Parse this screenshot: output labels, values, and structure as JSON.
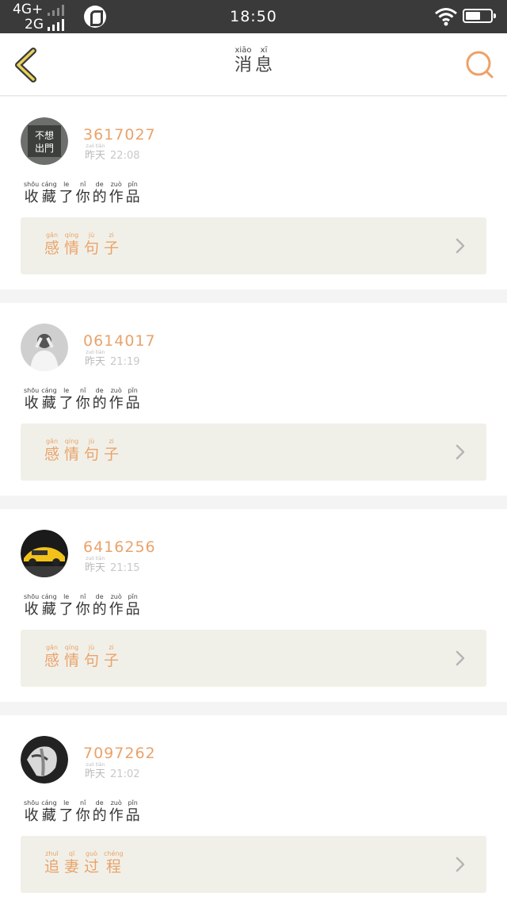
{
  "status_bar": {
    "network_top": "4G+",
    "network_bottom": "2G",
    "time": "18:50"
  },
  "header": {
    "title": [
      {
        "han": "消",
        "pin": "xiāo"
      },
      {
        "han": "息",
        "pin": "xī"
      }
    ]
  },
  "colors": {
    "accent": "#e9a36b",
    "work_bg": "#f1f0e8",
    "status_bg": "#3a3a3a"
  },
  "messages": [
    {
      "username": "3617027",
      "day": [
        {
          "han": "昨",
          "pin": "zuó"
        },
        {
          "han": "天",
          "pin": "tiān"
        }
      ],
      "time": "22:08",
      "action": [
        {
          "han": "收",
          "pin": "shōu"
        },
        {
          "han": "藏",
          "pin": "cáng"
        },
        {
          "han": "了",
          "pin": "le"
        },
        {
          "han": "你",
          "pin": "nǐ"
        },
        {
          "han": "的",
          "pin": "de"
        },
        {
          "han": "作",
          "pin": "zuò"
        },
        {
          "han": "品",
          "pin": "pǐn"
        }
      ],
      "work": [
        {
          "han": "感",
          "pin": "gǎn"
        },
        {
          "han": "情",
          "pin": "qíng"
        },
        {
          "han": "句",
          "pin": "jù"
        },
        {
          "han": "子",
          "pin": "zi"
        }
      ],
      "avatar": "avatar-text-image"
    },
    {
      "username": "0614017",
      "day": [
        {
          "han": "昨",
          "pin": "zuó"
        },
        {
          "han": "天",
          "pin": "tiān"
        }
      ],
      "time": "21:19",
      "action": [
        {
          "han": "收",
          "pin": "shōu"
        },
        {
          "han": "藏",
          "pin": "cáng"
        },
        {
          "han": "了",
          "pin": "le"
        },
        {
          "han": "你",
          "pin": "nǐ"
        },
        {
          "han": "的",
          "pin": "de"
        },
        {
          "han": "作",
          "pin": "zuò"
        },
        {
          "han": "品",
          "pin": "pǐn"
        }
      ],
      "work": [
        {
          "han": "感",
          "pin": "gǎn"
        },
        {
          "han": "情",
          "pin": "qíng"
        },
        {
          "han": "句",
          "pin": "jù"
        },
        {
          "han": "子",
          "pin": "zi"
        }
      ],
      "avatar": "avatar-person-photo"
    },
    {
      "username": "6416256",
      "day": [
        {
          "han": "昨",
          "pin": "zuó"
        },
        {
          "han": "天",
          "pin": "tiān"
        }
      ],
      "time": "21:15",
      "action": [
        {
          "han": "收",
          "pin": "shōu"
        },
        {
          "han": "藏",
          "pin": "cáng"
        },
        {
          "han": "了",
          "pin": "le"
        },
        {
          "han": "你",
          "pin": "nǐ"
        },
        {
          "han": "的",
          "pin": "de"
        },
        {
          "han": "作",
          "pin": "zuò"
        },
        {
          "han": "品",
          "pin": "pǐn"
        }
      ],
      "work": [
        {
          "han": "感",
          "pin": "gǎn"
        },
        {
          "han": "情",
          "pin": "qíng"
        },
        {
          "han": "句",
          "pin": "jù"
        },
        {
          "han": "子",
          "pin": "zi"
        }
      ],
      "avatar": "avatar-car-photo"
    },
    {
      "username": "7097262",
      "day": [
        {
          "han": "昨",
          "pin": "zuó"
        },
        {
          "han": "天",
          "pin": "tiān"
        }
      ],
      "time": "21:02",
      "action": [
        {
          "han": "收",
          "pin": "shōu"
        },
        {
          "han": "藏",
          "pin": "cáng"
        },
        {
          "han": "了",
          "pin": "le"
        },
        {
          "han": "你",
          "pin": "nǐ"
        },
        {
          "han": "的",
          "pin": "de"
        },
        {
          "han": "作",
          "pin": "zuò"
        },
        {
          "han": "品",
          "pin": "pǐn"
        }
      ],
      "work": [
        {
          "han": "追",
          "pin": "zhuī"
        },
        {
          "han": "妻",
          "pin": "qī"
        },
        {
          "han": "过",
          "pin": "guò"
        },
        {
          "han": "程",
          "pin": "chéng"
        }
      ],
      "avatar": "avatar-face-photo"
    }
  ]
}
